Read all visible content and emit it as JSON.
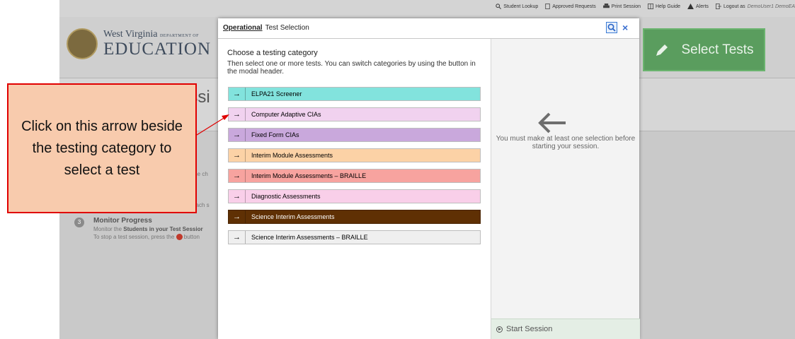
{
  "topnav": {
    "items": [
      "Student Lookup",
      "Approved Requests",
      "Print Session",
      "Help Guide",
      "Alerts",
      "Logout as"
    ],
    "user": "DemoUser1  DemoEA"
  },
  "logo": {
    "line1": "West Virginia",
    "line1_small": "DEPARTMENT OF",
    "line2": "EDUCATION"
  },
  "select_tests": {
    "label": "Select Tests",
    "icon": "pencil-icon"
  },
  "background": {
    "title_fragment": "essi",
    "side_fragment_1": "the ch",
    "side_fragment_2": "each s",
    "step_number": "3",
    "monitor_title": "Monitor Progress",
    "monitor_line1_pre": "Monitor the ",
    "monitor_line1_bold": "Students in your Test Sessior",
    "monitor_line2_pre": "To stop a test session, press the ",
    "monitor_line2_post": " button"
  },
  "modal": {
    "title_bold": "Operational",
    "title_rest": "Test Selection",
    "close": "×",
    "choose": "Choose a testing category",
    "instruction": "Then select one or more tests. You can switch categories by using the button in the modal header.",
    "categories": [
      {
        "label": "ELPA21 Screener",
        "color": "#82e3dd"
      },
      {
        "label": "Computer Adaptive CIAs",
        "color": "#f1d2ef"
      },
      {
        "label": "Fixed Form CIAs",
        "color": "#c9a8dc"
      },
      {
        "label": "Interim Module Assessments",
        "color": "#fcd2a6"
      },
      {
        "label": "Interim Module Assessments – BRAILLE",
        "color": "#f7a39f"
      },
      {
        "label": "Diagnostic Assessments",
        "color": "#f9cfe9"
      },
      {
        "label": "Science Interim Assessments",
        "color": "#5f3004"
      },
      {
        "label": "Science Interim Assessments – BRAILLE",
        "color": "#efefef"
      }
    ],
    "selection_message": "You must make at least one selection before starting your session.",
    "start_session": "Start Session"
  },
  "callout": {
    "text": "Click on this arrow beside the testing category to select a test"
  }
}
